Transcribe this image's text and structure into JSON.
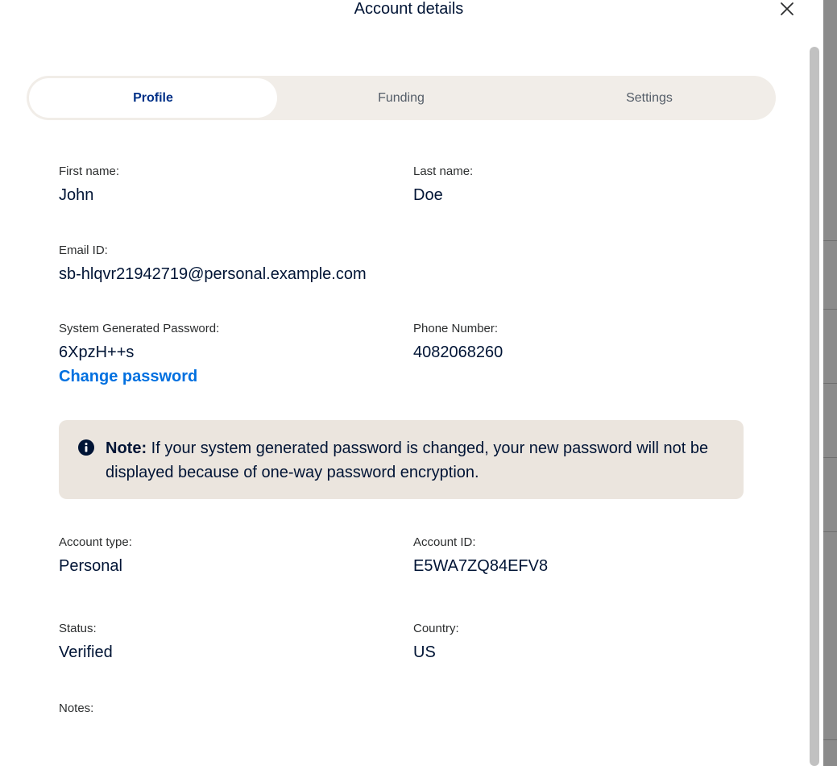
{
  "dialog": {
    "title": "Account details",
    "close_icon": "close-icon"
  },
  "tabs": [
    {
      "label": "Profile",
      "active": true
    },
    {
      "label": "Funding",
      "active": false
    },
    {
      "label": "Settings",
      "active": false
    }
  ],
  "profile": {
    "first_name": {
      "label": "First name:",
      "value": "John"
    },
    "last_name": {
      "label": "Last name:",
      "value": "Doe"
    },
    "email": {
      "label": "Email ID:",
      "value": "sb-hlqvr21942719@personal.example.com"
    },
    "password": {
      "label": "System Generated Password:",
      "value": "6XpzH++s",
      "change_link": "Change password"
    },
    "phone": {
      "label": "Phone Number:",
      "value": "4082068260"
    },
    "account_type": {
      "label": "Account type:",
      "value": "Personal"
    },
    "account_id": {
      "label": "Account ID:",
      "value": "E5WA7ZQ84EFV8"
    },
    "status": {
      "label": "Status:",
      "value": "Verified"
    },
    "country": {
      "label": "Country:",
      "value": "US"
    },
    "notes": {
      "label": "Notes:"
    }
  },
  "note": {
    "icon": "info-icon",
    "prefix": "Note:",
    "text": " If your system generated password is changed, your new password will not be displayed because of one-way password encryption."
  },
  "colors": {
    "link": "#0070e0",
    "active_tab_text": "#003087",
    "tab_bar_bg": "#f1ede8",
    "note_bg": "#ebe5de",
    "text": "#001435"
  }
}
